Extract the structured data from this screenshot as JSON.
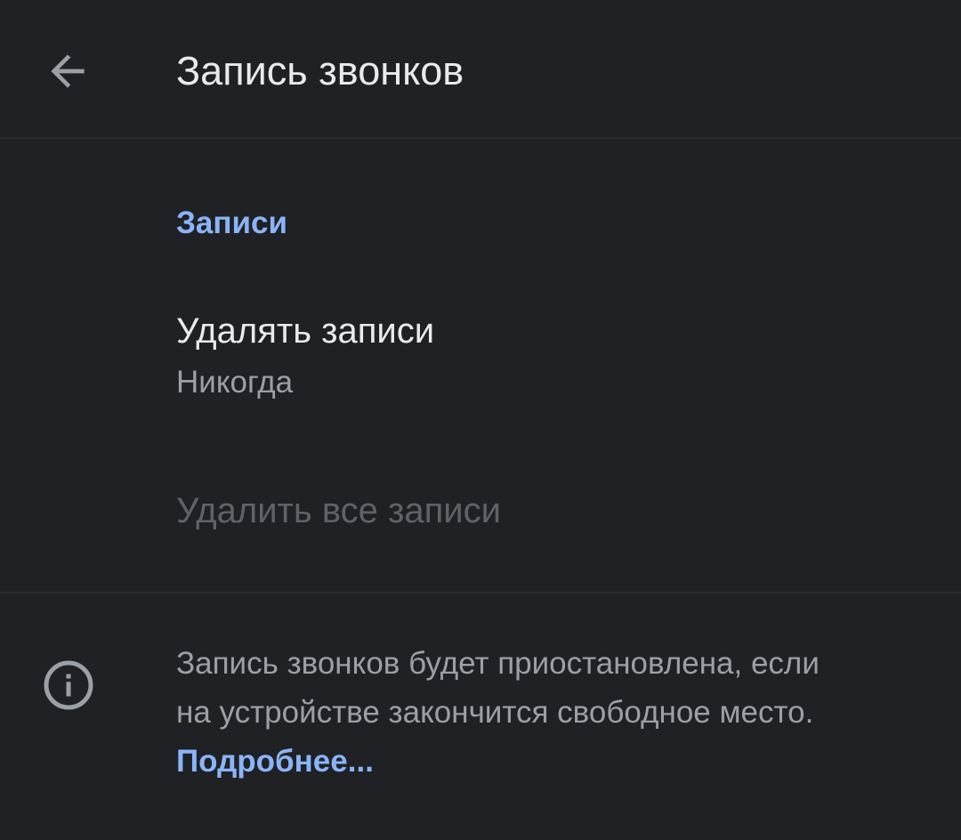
{
  "header": {
    "title": "Запись звонков",
    "back_icon": "arrow-back-icon"
  },
  "section": {
    "header": "Записи"
  },
  "preferences": {
    "delete_records": {
      "title": "Удалять записи",
      "summary": "Никогда"
    },
    "delete_all": {
      "title": "Удалить все записи",
      "enabled": false
    }
  },
  "footer": {
    "icon": "info-icon",
    "text_line1": "Запись звонков будет приостановлена, если",
    "text_line2": "на устройстве закончится свободное место.",
    "link": "Подробнее..."
  },
  "colors": {
    "background": "#202124",
    "accent": "#8ab4f8",
    "primary_text": "#e8eaed",
    "secondary_text": "#9aa0a6",
    "disabled_text": "#5f6368"
  }
}
